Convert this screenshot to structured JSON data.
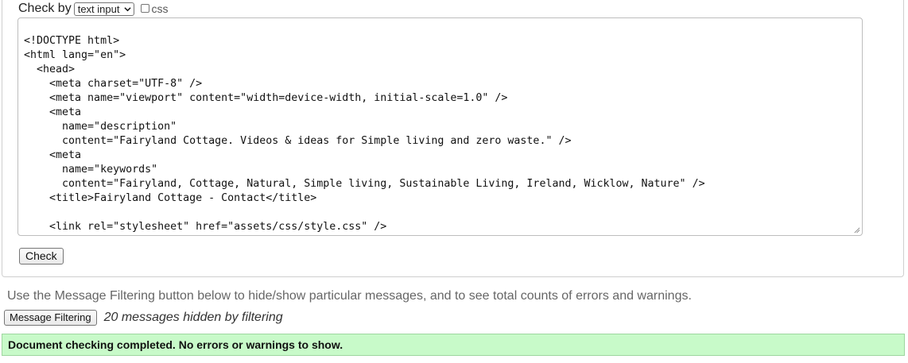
{
  "form": {
    "check_by_label": "Check by",
    "check_by_select": {
      "value": "text input",
      "icon": "chevron-down-icon"
    },
    "css_checkbox": {
      "label": "css",
      "checked": false
    },
    "textarea": {
      "value": "<!DOCTYPE html>\n<html lang=\"en\">\n  <head>\n    <meta charset=\"UTF-8\" />\n    <meta name=\"viewport\" content=\"width=device-width, initial-scale=1.0\" />\n    <meta\n      name=\"description\"\n      content=\"Fairyland Cottage. Videos & ideas for Simple living and zero waste.\" />\n    <meta\n      name=\"keywords\"\n      content=\"Fairyland, Cottage, Natural, Simple living, Sustainable Living, Ireland, Wicklow, Nature\" />\n    <title>Fairyland Cottage - Contact</title>\n\n    <link rel=\"stylesheet\" href=\"assets/css/style.css\" />"
    },
    "check_button": "Check"
  },
  "filtering": {
    "help_text": "Use the Message Filtering button below to hide/show particular messages, and to see total counts of errors and warnings.",
    "button_label": "Message Filtering",
    "hidden_count_text": "20 messages hidden by filtering"
  },
  "result": {
    "message": "Document checking completed. No errors or warnings to show.",
    "status_color": "#c8fac9"
  }
}
